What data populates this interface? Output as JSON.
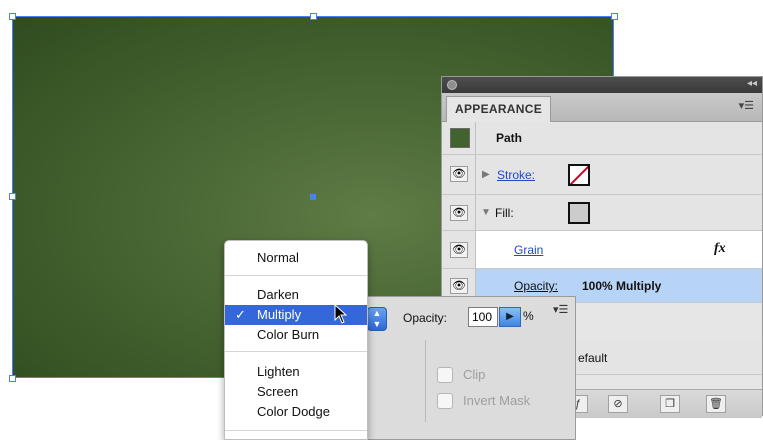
{
  "panel": {
    "tab_label": "APPEARANCE",
    "menu_icon": "panel-menu-icon",
    "rows": {
      "path_label": "Path",
      "stroke_label": "Stroke:",
      "fill_label": "Fill:",
      "grain_label": "Grain",
      "fx_label": "fx",
      "opacity_label": "Opacity:",
      "opacity_value": "100% Multiply",
      "default_label": "efault"
    }
  },
  "transparency": {
    "opacity_label": "Opacity:",
    "opacity_value": "100",
    "percent": "%",
    "clip_label": "Clip",
    "invert_mask_label": "Invert Mask"
  },
  "blend_menu": {
    "items": [
      "Normal",
      "Darken",
      "Multiply",
      "Color Burn",
      "Lighten",
      "Screen",
      "Color Dodge"
    ],
    "selected": "Multiply",
    "check": "✓"
  },
  "colors": {
    "selection": "#4a7ff7",
    "highlight": "#3468d8",
    "artwork": "#42622e"
  }
}
